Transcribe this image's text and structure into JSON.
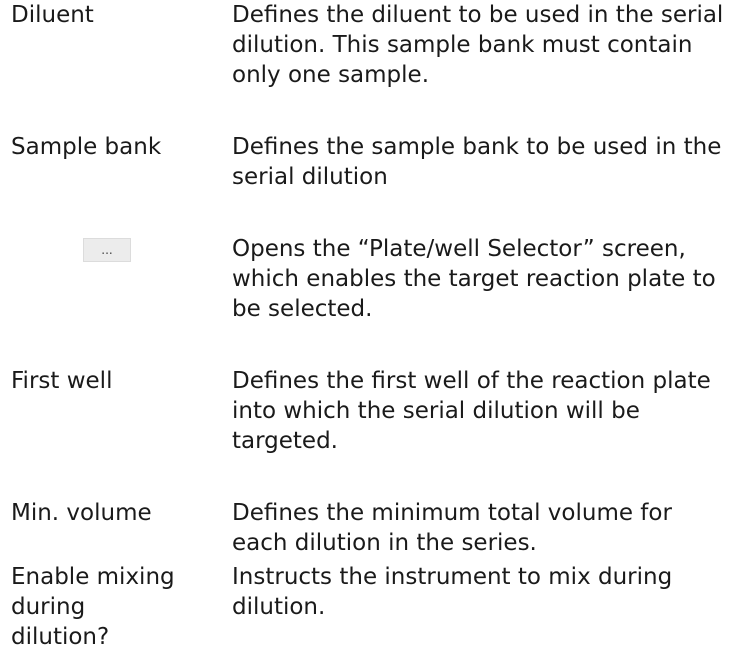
{
  "rows": [
    {
      "term": "Diluent",
      "description": "Defines the diluent to be used in the serial\ndilution. This sample bank must contain\nonly one sample."
    },
    {
      "term": "Sample bank",
      "description": "Defines the sample bank to be used in the\nserial dilution"
    },
    {
      "button_label": "...",
      "description": "Opens the “Plate/well Selector” screen,\nwhich enables the target reaction plate to\nbe selected."
    },
    {
      "term": "First well",
      "description": "Defines the first well of the reaction plate\ninto which the serial dilution will be\ntargeted."
    },
    {
      "term": "Min. volume",
      "description": "Defines the minimum total volume for\neach dilution in the series."
    },
    {
      "term": "Enable mixing\nduring\ndilution?",
      "description": "Instructs the instrument to mix during\ndilution."
    }
  ]
}
